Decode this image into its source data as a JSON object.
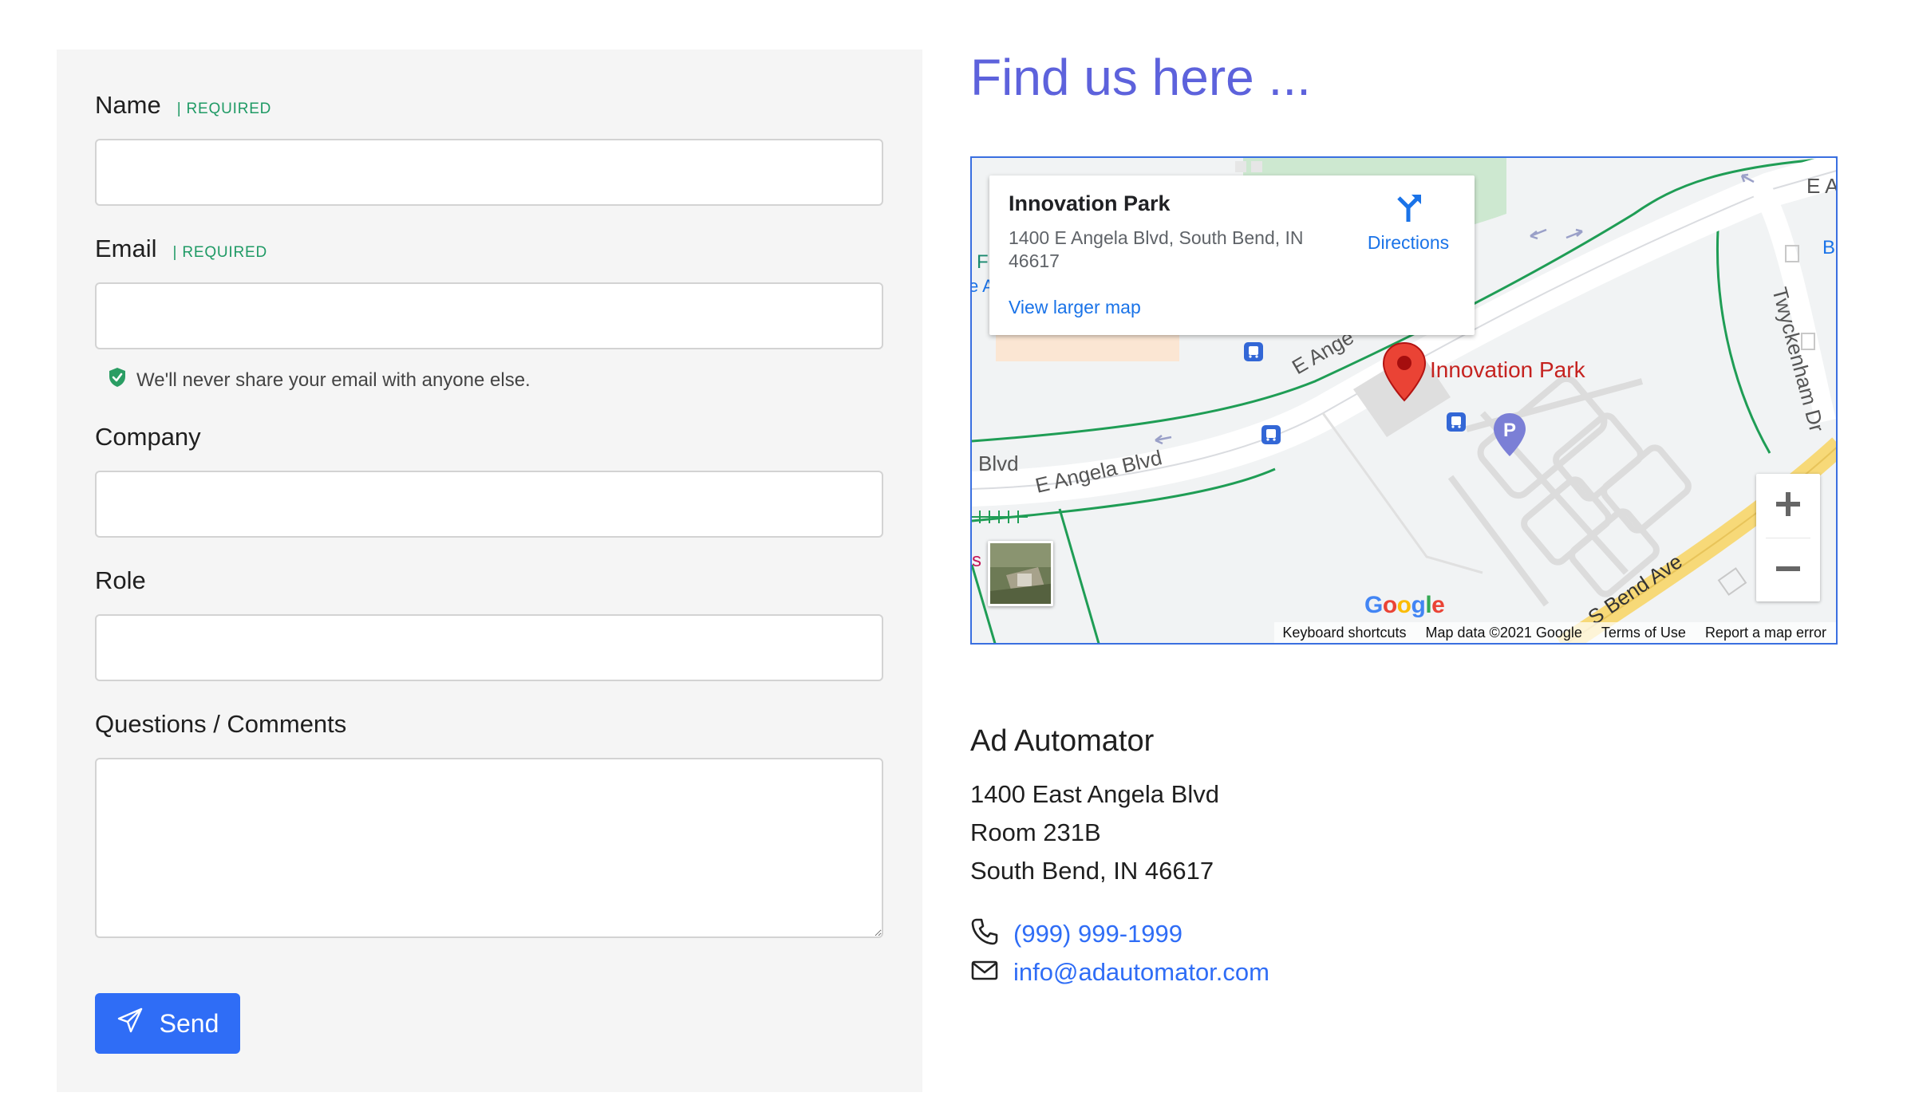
{
  "form": {
    "name_label": "Name",
    "email_label": "Email",
    "required_tag": "| REQUIRED",
    "email_help": "We'll never share your email with anyone else.",
    "company_label": "Company",
    "role_label": "Role",
    "comments_label": "Questions / Comments",
    "send_label": "Send",
    "name_value": "",
    "email_value": "",
    "company_value": "",
    "role_value": "",
    "comments_value": ""
  },
  "location": {
    "heading": "Find us here ...",
    "map": {
      "place_title": "Innovation Park",
      "place_address": "1400 E Angela Blvd, South Bend, IN 46617",
      "view_larger_map": "View larger map",
      "directions": "Directions",
      "marker_label": "Innovation Park",
      "street_labels": [
        "E Angela Blvd",
        "E Ange",
        "Blvd",
        "Twyckenham Dr",
        "S Bend Ave",
        "E A",
        "F",
        "B",
        "s",
        "e A"
      ],
      "google_logo": "Google",
      "footer": [
        "Keyboard shortcuts",
        "Map data ©2021 Google",
        "Terms of Use",
        "Report a map error"
      ],
      "zoom_in": "+",
      "zoom_out": "−"
    },
    "company_name": "Ad Automator",
    "address_lines": [
      "1400 East Angela Blvd",
      "Room 231B",
      "South Bend, IN 46617"
    ],
    "phone": "(999) 999-1999",
    "email": "info@adautomator.com"
  },
  "colors": {
    "accent": "#2f6df6",
    "heading": "#5d62dc",
    "required": "#1f9a65",
    "panel_bg": "#f5f5f5",
    "map_pin": "#ea4335"
  },
  "icons": [
    "shield-check-icon",
    "paper-plane-icon",
    "directions-icon",
    "map-pin-icon",
    "parking-icon",
    "bus-stop-icon",
    "phone-icon",
    "envelope-icon",
    "zoom-in-icon",
    "zoom-out-icon"
  ]
}
